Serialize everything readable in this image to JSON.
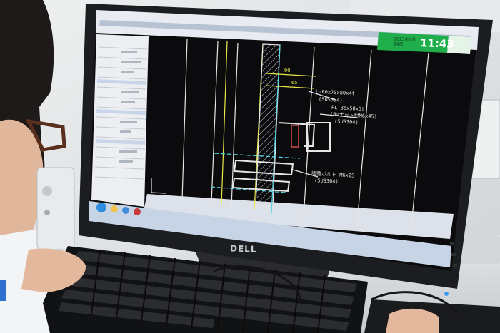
{
  "monitor": {
    "brand": "DELL"
  },
  "clock_gadget": {
    "time": "11:43",
    "date_line1": "2015年6月",
    "date_line2": "24日"
  },
  "cad_drawing": {
    "dimensions": [
      "90",
      "65"
    ],
    "annotations": [
      "L-60x70x80x4t",
      "(SUS304)",
      "PL-38x50x5t",
      "(B=ナット付M6x45)",
      "(SUS304)",
      "調整ボルト M6x25",
      "(SUS304)"
    ]
  },
  "colors": {
    "cad_background": "#0b0b0d",
    "monitor_bezel": "#1c1d20",
    "clock_green": "#1fae4b",
    "cad_yellow": "#e8e84a",
    "cad_cyan": "#58d6e6"
  }
}
